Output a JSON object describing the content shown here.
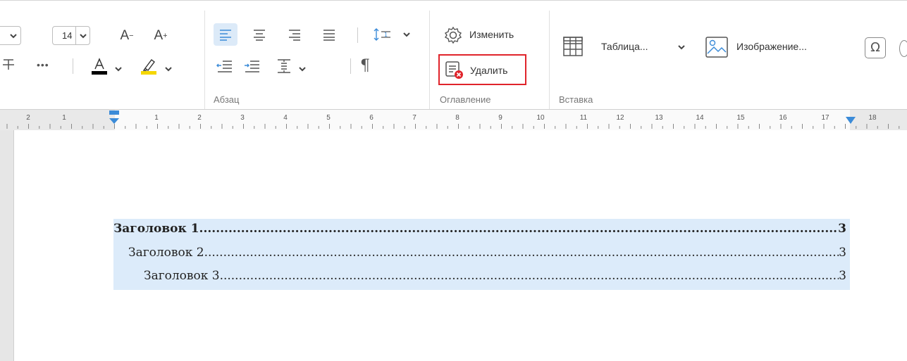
{
  "font": {
    "size": "14"
  },
  "groups": {
    "paragraph": "Абзац",
    "toc": "Оглавление",
    "insert": "Вставка"
  },
  "toc_controls": {
    "edit": "Изменить",
    "delete": "Удалить"
  },
  "insert": {
    "table": "Таблица...",
    "image": "Изображение..."
  },
  "ruler": {
    "numbers": [
      "2",
      "1",
      "1",
      "2",
      "3",
      "4",
      "5",
      "6",
      "7",
      "8",
      "9",
      "10",
      "11",
      "12",
      "13",
      "14",
      "15",
      "16",
      "17",
      "18"
    ]
  },
  "toc_entries": [
    {
      "title": "Заголовок 1",
      "page": "3"
    },
    {
      "title": "Заголовок 2",
      "page": "3"
    },
    {
      "title": "Заголовок 3",
      "page": "3"
    }
  ],
  "colors": {
    "accent": "#3b8bd8",
    "highlight_box": "#e0242b",
    "font_color": "#000000",
    "highlight_color": "#f5d700",
    "toc_bg": "#dcebfa"
  }
}
